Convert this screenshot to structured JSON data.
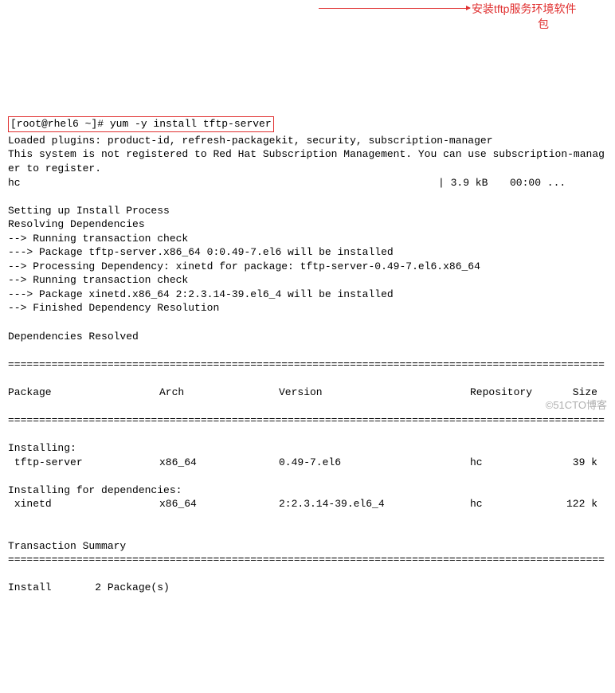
{
  "prompt": "[root@rhel6 ~]# ",
  "command": "yum -y install tftp-server",
  "annotation": {
    "line1": "安装tftp服务环境软件",
    "line2": "包"
  },
  "out": {
    "loaded": "Loaded plugins: product-id, refresh-packagekit, security, subscription-manager",
    "notreg": "This system is not registered to Red Hat Subscription Management. You can use subscription-manager to register.",
    "repo": "hc",
    "repo_size": "| 3.9 kB",
    "repo_time": "00:00 ...",
    "setup": "Setting up Install Process",
    "resolve": "Resolving Dependencies",
    "l1": "--> Running transaction check",
    "l2": "---> Package tftp-server.x86_64 0:0.49-7.el6 will be installed",
    "l3": "--> Processing Dependency: xinetd for package: tftp-server-0.49-7.el6.x86_64",
    "l4": "--> Running transaction check",
    "l5": "---> Package xinetd.x86_64 2:2.3.14-39.el6_4 will be installed",
    "l6": "--> Finished Dependency Resolution",
    "deps": "Dependencies Resolved",
    "hdr": {
      "pkg": "Package",
      "arch": "Arch",
      "ver": "Version",
      "repo": "Repository",
      "size": "Size"
    },
    "sec_install": "Installing:",
    "r1": {
      "pkg": " tftp-server",
      "arch": "x86_64",
      "ver": "0.49-7.el6",
      "repo": "hc",
      "size": "39 k"
    },
    "sec_deps": "Installing for dependencies:",
    "r2": {
      "pkg": " xinetd",
      "arch": "x86_64",
      "ver": "2:2.3.14-39.el6_4",
      "repo": "hc",
      "size": "122 k"
    },
    "txsum": "Transaction Summary",
    "install_count": "Install       2 Package(s)"
  },
  "rule_eq": "================================================================================================",
  "rule_dash": "------------------------------------------------------------------------------------------------",
  "watermark": "©51CTO博客"
}
